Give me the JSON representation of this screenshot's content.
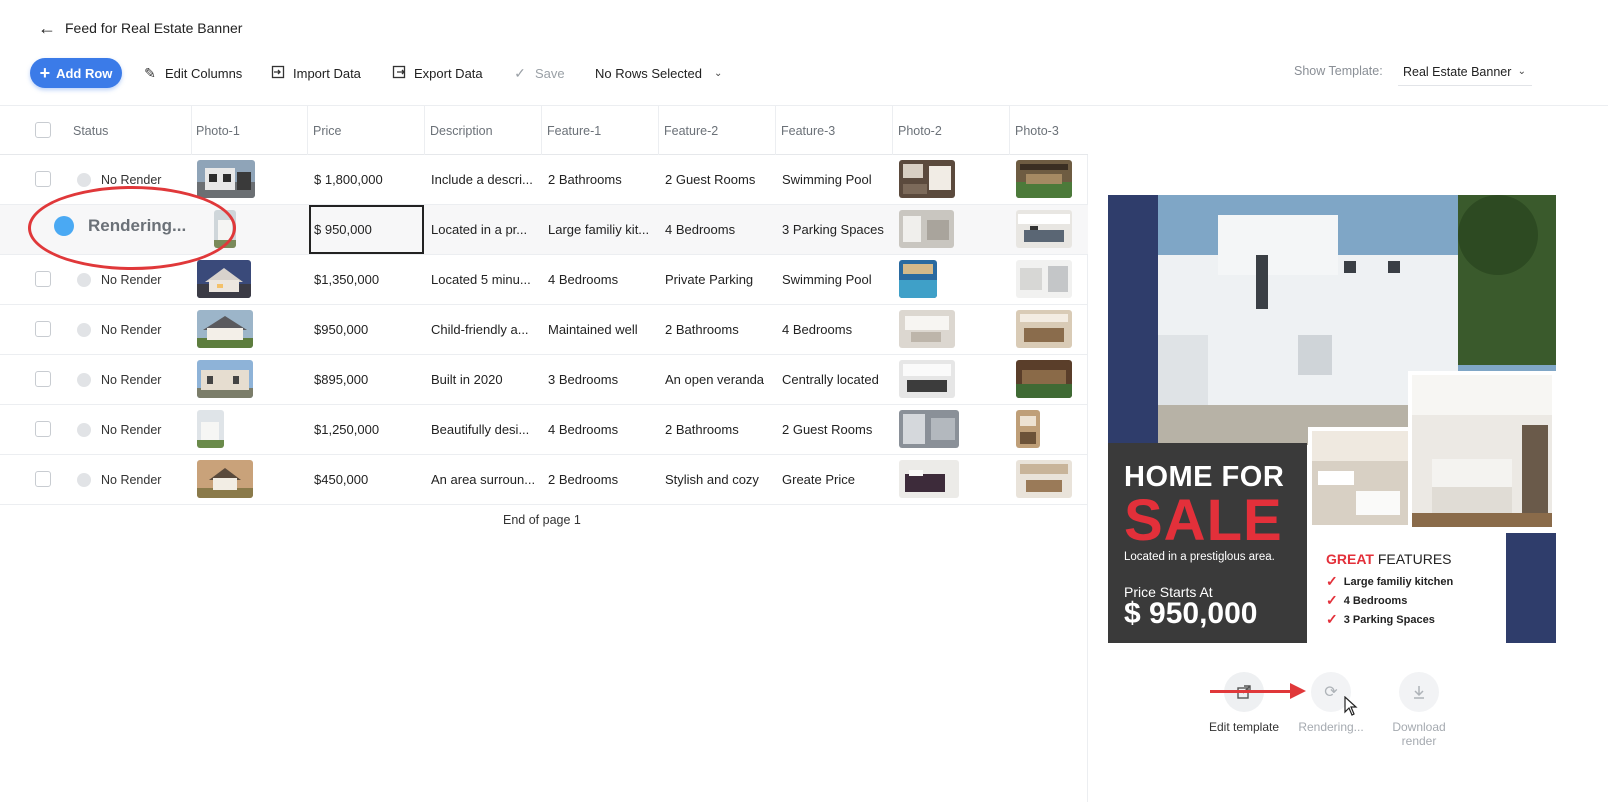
{
  "header": {
    "back_icon": "arrow-left-icon",
    "title": "Feed for Real Estate Banner"
  },
  "toolbar": {
    "add_row": "Add Row",
    "edit_columns": "Edit Columns",
    "import_data": "Import Data",
    "export_data": "Export Data",
    "save": "Save",
    "rows_selected": "No Rows Selected",
    "show_template_label": "Show Template:",
    "template_value": "Real Estate Banner"
  },
  "table": {
    "columns": [
      "Status",
      "Photo-1",
      "Price",
      "Description",
      "Feature-1",
      "Feature-2",
      "Feature-3",
      "Photo-2",
      "Photo-3"
    ],
    "rows": [
      {
        "status": "No Render",
        "price": "$ 1,800,000",
        "description": "Include a descri...",
        "f1": "2 Bathrooms",
        "f2": "2 Guest Rooms",
        "f3": "Swimming Pool"
      },
      {
        "status": "Rendering...",
        "price": "$ 950,000",
        "description": "Located in a pr...",
        "f1": "Large familiy kit...",
        "f2": "4 Bedrooms",
        "f3": "3 Parking Spaces"
      },
      {
        "status": "No Render",
        "price": "$1,350,000",
        "description": "Located 5 minu...",
        "f1": "4 Bedrooms",
        "f2": "Private Parking",
        "f3": "Swimming Pool"
      },
      {
        "status": "No Render",
        "price": "$950,000",
        "description": "Child-friendly a...",
        "f1": "Maintained well",
        "f2": "2 Bathrooms",
        "f3": "4 Bedrooms"
      },
      {
        "status": "No Render",
        "price": "$895,000",
        "description": "Built in 2020",
        "f1": "3 Bedrooms",
        "f2": "An open veranda",
        "f3": "Centrally located"
      },
      {
        "status": "No Render",
        "price": "$1,250,000",
        "description": "Beautifully desi...",
        "f1": "4 Bedrooms",
        "f2": "2 Bathrooms",
        "f3": "2 Guest Rooms"
      },
      {
        "status": "No Render",
        "price": "$450,000",
        "description": "An area surroun...",
        "f1": "2 Bedrooms",
        "f2": "Stylish and cozy",
        "f3": "Greate Price"
      }
    ],
    "end_of_page": "End of page 1"
  },
  "preview": {
    "home_for": "HOME FOR",
    "sale": "SALE",
    "location": "Located in a prestiglous area.",
    "price_label": "Price Starts At",
    "price": "$ 950,000",
    "great": "GREAT",
    "features_word": "FEATURES",
    "features": [
      "Large familiy kitchen",
      "4 Bedrooms",
      "3 Parking Spaces"
    ],
    "accent_red": "#e3303a",
    "navy": "#2f3d6b"
  },
  "actions": {
    "edit_template": "Edit template",
    "rendering": "Rendering...",
    "download_render": "Download render"
  },
  "colors": {
    "primary": "#3b7be8",
    "render_blue": "#4aa9f3",
    "annotation_red": "#e0383a"
  }
}
